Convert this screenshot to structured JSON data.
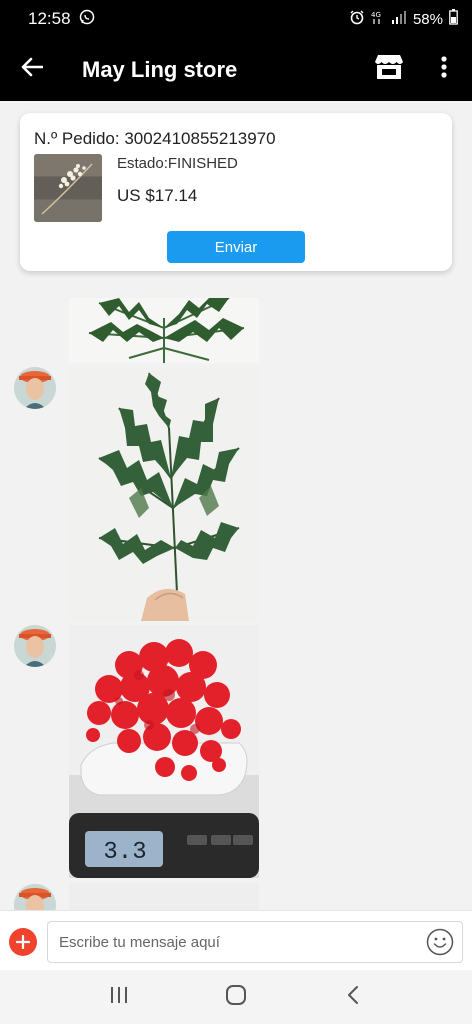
{
  "status_bar": {
    "time": "12:58",
    "battery": "58%",
    "icons": [
      "whatsapp-icon",
      "alarm-icon",
      "4g-icon",
      "signal-icon",
      "battery-icon"
    ]
  },
  "header": {
    "title": "May Ling store",
    "icons": [
      "back-arrow-icon",
      "store-icon",
      "more-vertical-icon"
    ]
  },
  "order": {
    "number_label": "N.º Pedido: 3002410855213970",
    "status_label": "Estado:FINISHED",
    "price": "US $17.14",
    "send_label": "Enviar"
  },
  "chat": {
    "messages": [
      {
        "type": "image",
        "subject": "fern"
      },
      {
        "type": "image",
        "subject": "fern-held"
      },
      {
        "type": "image",
        "subject": "red-flowers-on-scale",
        "scale_reading": "3.3"
      },
      {
        "type": "image",
        "subject": "partial"
      }
    ]
  },
  "input": {
    "placeholder": "Escribe tu mensaje aquí"
  },
  "colors": {
    "accent_blue": "#1a9bf0",
    "plus_red": "#f0432d",
    "bar_black": "#000000"
  }
}
